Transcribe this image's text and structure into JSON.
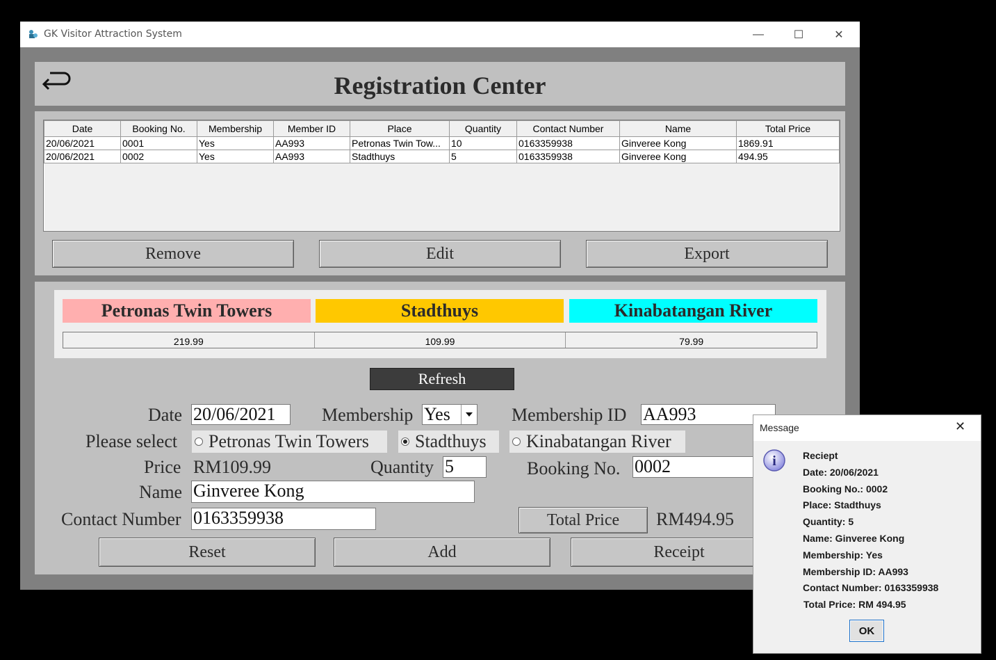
{
  "window": {
    "title": "GK Visitor Attraction System",
    "controls": {
      "minimize": "—",
      "maximize": "☐",
      "close": "✕"
    }
  },
  "header": {
    "back_icon": "↩",
    "title": "Registration Center"
  },
  "table": {
    "columns": [
      "Date",
      "Booking No.",
      "Membership",
      "Member ID",
      "Place",
      "Quantity",
      "Contact Number",
      "Name",
      "Total Price"
    ],
    "rows": [
      [
        "20/06/2021",
        "0001",
        "Yes",
        "AA993",
        "Petronas Twin Tow...",
        "10",
        "0163359938",
        "Ginveree Kong",
        "1869.91"
      ],
      [
        "20/06/2021",
        "0002",
        "Yes",
        "AA993",
        "Stadthuys",
        "5",
        "0163359938",
        "Ginveree Kong",
        "494.95"
      ]
    ]
  },
  "table_actions": {
    "remove": "Remove",
    "edit": "Edit",
    "export": "Export"
  },
  "places": [
    {
      "name": "Petronas Twin Towers",
      "price": "219.99",
      "color": "#ffafaf"
    },
    {
      "name": "Stadthuys",
      "price": "109.99",
      "color": "#ffc800"
    },
    {
      "name": "Kinabatangan River",
      "price": "79.99",
      "color": "#00ffff"
    }
  ],
  "refresh_label": "Refresh",
  "form": {
    "date_label": "Date",
    "date_value": "20/06/2021",
    "membership_label": "Membership",
    "membership_value": "Yes",
    "membership_id_label": "Membership ID",
    "membership_id_value": "AA993",
    "select_label": "Please select",
    "options": [
      "Petronas Twin Towers",
      "Stadthuys",
      "Kinabatangan River"
    ],
    "selected_option": "Stadthuys",
    "price_label": "Price",
    "price_value": "RM109.99",
    "quantity_label": "Quantity",
    "quantity_value": "5",
    "booking_label": "Booking No.",
    "booking_value": "0002",
    "name_label": "Name",
    "name_value": "Ginveree Kong",
    "contact_label": "Contact Number",
    "contact_value": "0163359938",
    "total_price_button": "Total Price",
    "total_price_value": "RM494.95"
  },
  "bottom_actions": {
    "reset": "Reset",
    "add": "Add",
    "receipt": "Receipt"
  },
  "dialog": {
    "title": "Message",
    "close": "✕",
    "icon": "i",
    "lines": [
      "Reciept",
      "Date: 20/06/2021",
      "Booking No.: 0002",
      "Place: Stadthuys",
      "Quantity: 5",
      "Name: Ginveree Kong",
      "Membership: Yes",
      "Membership ID: AA993",
      "Contact Number: 0163359938",
      "Total Price: RM 494.95"
    ],
    "ok": "OK"
  },
  "colors": {
    "refresh_bg": "#3c3c3c",
    "panel": "#c0c0c0",
    "frame": "#808080"
  }
}
